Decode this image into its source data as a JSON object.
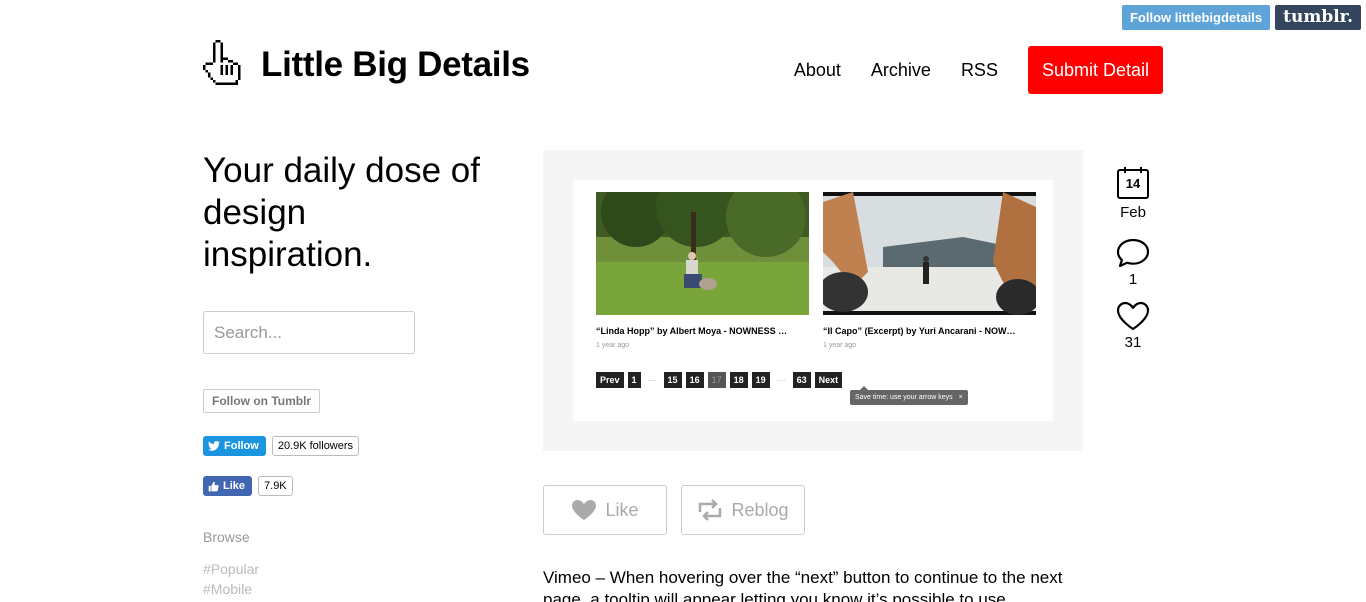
{
  "tumblr_controls": {
    "follow_label": "Follow littlebigdetails",
    "logo_label": "tumblr."
  },
  "header": {
    "title": "Little Big Details",
    "logo_icon": "pointer-hand-icon",
    "nav": {
      "about": "About",
      "archive": "Archive",
      "rss": "RSS",
      "submit": "Submit Detail"
    }
  },
  "sidebar": {
    "tagline": "Your daily dose of design inspiration.",
    "search_placeholder": "Search...",
    "follow_tumblr": "Follow on Tumblr",
    "twitter": {
      "label": "Follow",
      "count": "20.9K followers"
    },
    "facebook": {
      "label": "Like",
      "count": "7.9K"
    },
    "browse_title": "Browse",
    "browse_items": [
      "#Popular",
      "#Mobile"
    ]
  },
  "post": {
    "screenshot": {
      "videos": [
        {
          "title": "“Linda Hopp” by Albert Moya - NOWNESS …",
          "time": "1 year ago"
        },
        {
          "title": "“Il Capo” (Excerpt) by Yuri Ancarani - NOW…",
          "time": "1 year ago"
        }
      ],
      "pager": {
        "prev": "Prev",
        "pages_left": [
          "1"
        ],
        "ellipsis": "···",
        "pages_mid": [
          "15",
          "16"
        ],
        "current": "17",
        "pages_right": [
          "18",
          "19"
        ],
        "last": "63",
        "next": "Next"
      },
      "tooltip": "Save time: use your arrow keys",
      "tooltip_close": "×"
    },
    "meta": {
      "day": "14",
      "month": "Feb",
      "comments": "1",
      "likes": "31"
    },
    "actions": {
      "like": "Like",
      "reblog": "Reblog"
    },
    "text": "Vimeo – When hovering over the “next” button to continue to the next page, a tooltip will appear letting you know it’s possible to use"
  },
  "colors": {
    "submit_red": "#ff0000",
    "tumblr_blue": "#5fa4d8",
    "tumblr_navy": "#34465d",
    "twitter_blue": "#1b95e0",
    "facebook_blue": "#4267b2"
  }
}
